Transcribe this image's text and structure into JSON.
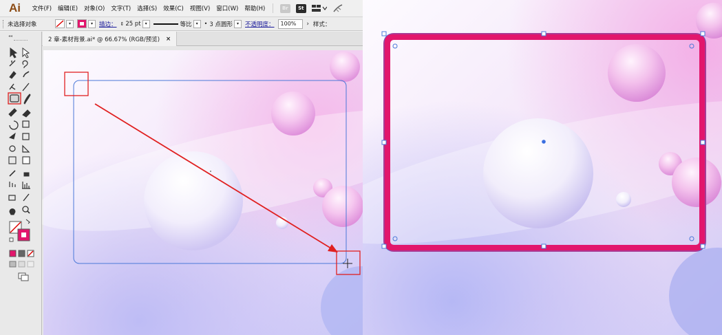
{
  "app": {
    "logo": "Ai"
  },
  "menus": [
    "文件(F)",
    "编辑(E)",
    "对象(O)",
    "文字(T)",
    "选择(S)",
    "效果(C)",
    "视图(V)",
    "窗口(W)",
    "帮助(H)"
  ],
  "menu_buttons": {
    "br": "Br",
    "st": "St"
  },
  "control": {
    "selection_label": "未选择对象",
    "stroke_label": "描边：",
    "stroke_value": "25 pt",
    "profile_label": "等比",
    "brush_label": "3 点圆形",
    "opacity_label": "不透明度：",
    "opacity_value": "100%",
    "style_label": "样式："
  },
  "document": {
    "tab_title": "2 章-素材背景.ai* @ 66.67% (RGB/预览)",
    "close": "×"
  },
  "colors": {
    "stroke_pink": "#e2166c",
    "guide_blue": "#4a78d8",
    "annotation_red": "#e02020",
    "anchor_blue": "#3a6ee0"
  }
}
